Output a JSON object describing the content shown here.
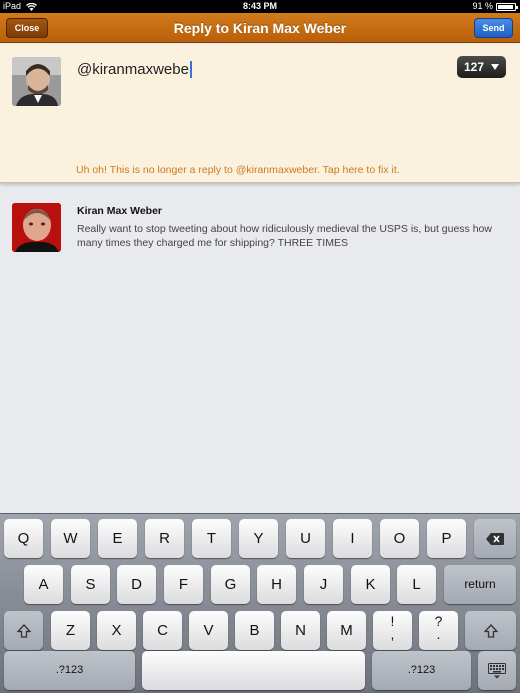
{
  "status_bar": {
    "device": "iPad",
    "time": "8:43 PM",
    "battery_text": "91 %",
    "battery_level": 0.91
  },
  "nav": {
    "title": "Reply to Kiran Max Weber",
    "close_label": "Close",
    "send_label": "Send"
  },
  "compose": {
    "text": "@kiranmaxwebe",
    "char_count": "127",
    "warning": "Uh oh! This is no longer a reply to @kiranmaxweber. Tap here to fix it."
  },
  "tweet": {
    "name": "Kiran Max Weber",
    "text": "Really want to stop tweeting about how ridiculously medieval the USPS is, but guess how many times they charged me for shipping? THREE TIMES"
  },
  "keyboard": {
    "row1": [
      "Q",
      "W",
      "E",
      "R",
      "T",
      "Y",
      "U",
      "I",
      "O",
      "P"
    ],
    "row2": [
      "A",
      "S",
      "D",
      "F",
      "G",
      "H",
      "J",
      "K",
      "L"
    ],
    "row3": [
      "Z",
      "X",
      "C",
      "V",
      "B",
      "N",
      "M"
    ],
    "return_label": "return",
    "symbols_label": ".?123",
    "exclaim_top": "!",
    "exclaim_bottom": ",",
    "question_top": "?",
    "question_bottom": "."
  },
  "colors": {
    "nav_orange": "#c66d12",
    "warning_orange": "#cf7a1e",
    "send_blue": "#2f73d6",
    "compose_bg": "#fbf1df"
  },
  "icons": {
    "wifi": "wifi-icon",
    "battery": "battery-icon",
    "backspace": "backspace-icon",
    "shift": "shift-icon",
    "hide_keyboard": "keyboard-hide-icon",
    "counter_arrow": "chevron-down-icon"
  }
}
